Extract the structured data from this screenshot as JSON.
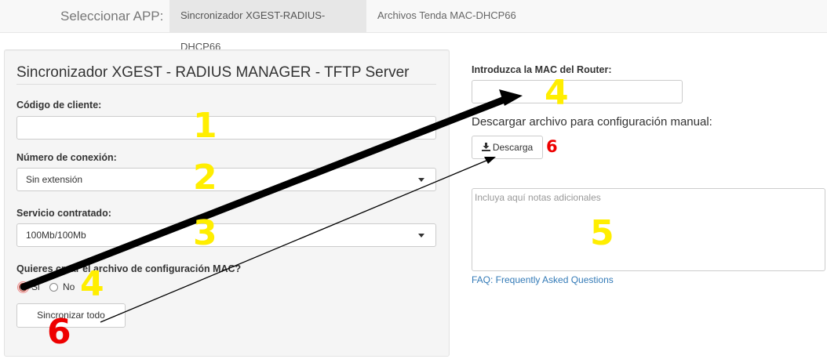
{
  "navbar": {
    "brand": "Seleccionar APP:",
    "tabs": [
      {
        "label": "Sincronizador XGEST-RADIUS-DHCP66",
        "active": true
      },
      {
        "label": "Archivos Tenda MAC-DHCP66",
        "active": false
      }
    ]
  },
  "left_panel": {
    "title": "Sincronizador XGEST - RADIUS MANAGER - TFTP Server",
    "client_code": {
      "label": "Código de cliente:",
      "value": ""
    },
    "connection_number": {
      "label": "Número de conexión:",
      "selected": "Sin extensión"
    },
    "service": {
      "label": "Servicio contratado:",
      "selected": "100Mb/100Mb"
    },
    "mac_question": {
      "label": "Quieres crear el archivo de configuración MAC?",
      "options": [
        "Si",
        "No"
      ],
      "selected": "Si"
    },
    "sync_button": "Sincronizar todo"
  },
  "right_panel": {
    "mac_label": "Introduzca la MAC del Router:",
    "mac_value": "",
    "manual_download_text": "Descargar archivo para configuración manual:",
    "download_button": "Descarga",
    "download_icon": "download-icon",
    "notes_placeholder": "Incluya aquí notas adicionales",
    "faq_link": "FAQ: Frequently Asked Questions"
  },
  "annotations": {
    "n1": "1",
    "n2": "2",
    "n3": "3",
    "n4a": "4",
    "n4b": "4",
    "n5": "5",
    "n6a": "6",
    "n6b": "6",
    "yellow": "#ffee00",
    "red": "#ee0000"
  }
}
